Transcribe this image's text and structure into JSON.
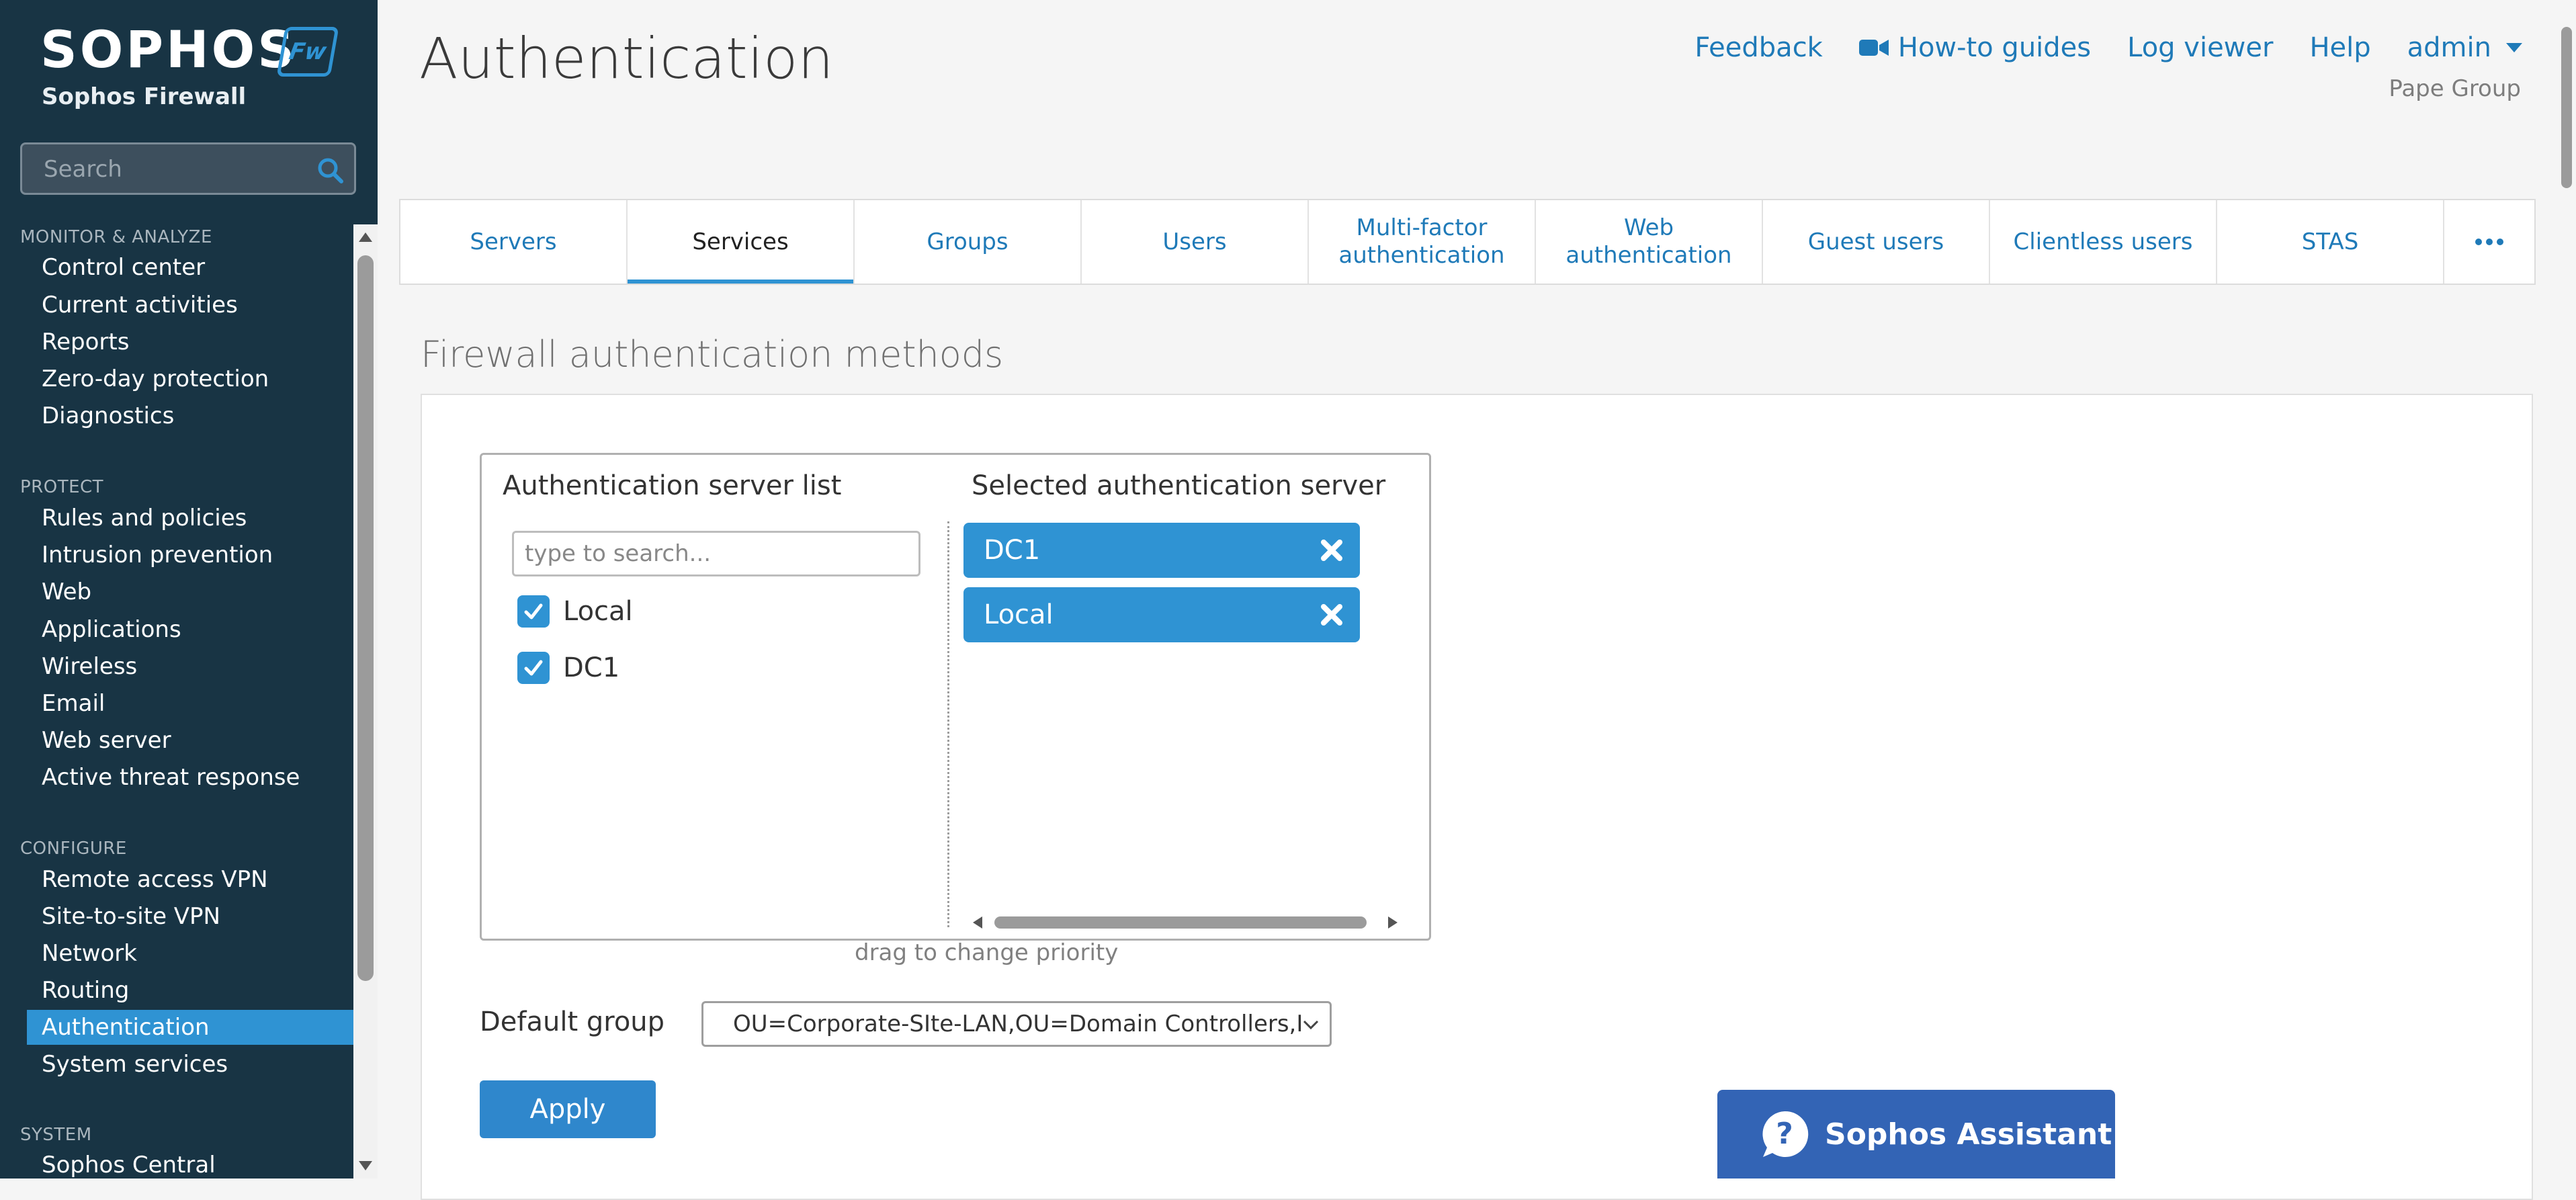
{
  "app": {
    "logo": "SOPHOS",
    "badge": "Fw",
    "product": "Sophos Firewall"
  },
  "sidebar": {
    "search_placeholder": "Search",
    "sections": [
      {
        "title": "MONITOR & ANALYZE",
        "items": [
          "Control center",
          "Current activities",
          "Reports",
          "Zero-day protection",
          "Diagnostics"
        ]
      },
      {
        "title": "PROTECT",
        "items": [
          "Rules and policies",
          "Intrusion prevention",
          "Web",
          "Applications",
          "Wireless",
          "Email",
          "Web server",
          "Active threat response"
        ]
      },
      {
        "title": "CONFIGURE",
        "items": [
          "Remote access VPN",
          "Site-to-site VPN",
          "Network",
          "Routing",
          "Authentication",
          "System services"
        ]
      },
      {
        "title": "SYSTEM",
        "items": [
          "Sophos Central"
        ]
      }
    ],
    "active_item": "Authentication"
  },
  "header": {
    "title": "Authentication",
    "links": {
      "feedback": "Feedback",
      "howto": "How-to guides",
      "log_viewer": "Log viewer",
      "help": "Help",
      "user": "admin"
    },
    "org": "Pape Group"
  },
  "tabs": [
    "Servers",
    "Services",
    "Groups",
    "Users",
    "Multi-factor authentication",
    "Web authentication",
    "Guest users",
    "Clientless users",
    "STAS"
  ],
  "active_tab": "Services",
  "section": {
    "title": "Firewall authentication methods"
  },
  "server_list": {
    "heading": "Authentication server list",
    "search_placeholder": "type to search...",
    "items": [
      {
        "label": "Local",
        "checked": true
      },
      {
        "label": "DC1",
        "checked": true
      }
    ]
  },
  "selected": {
    "heading": "Selected authentication server",
    "items": [
      "DC1",
      "Local"
    ]
  },
  "drag_hint": "drag to change priority",
  "default_group": {
    "label": "Default group",
    "value": "OU=Corporate-SIte-LAN,OU=Domain Controllers,I"
  },
  "apply_label": "Apply",
  "assistant_label": "Sophos Assistant",
  "colors": {
    "sidebar_bg": "#183444",
    "accent": "#2f93d3",
    "link": "#1f7ab8",
    "assistant": "#3364b5"
  }
}
